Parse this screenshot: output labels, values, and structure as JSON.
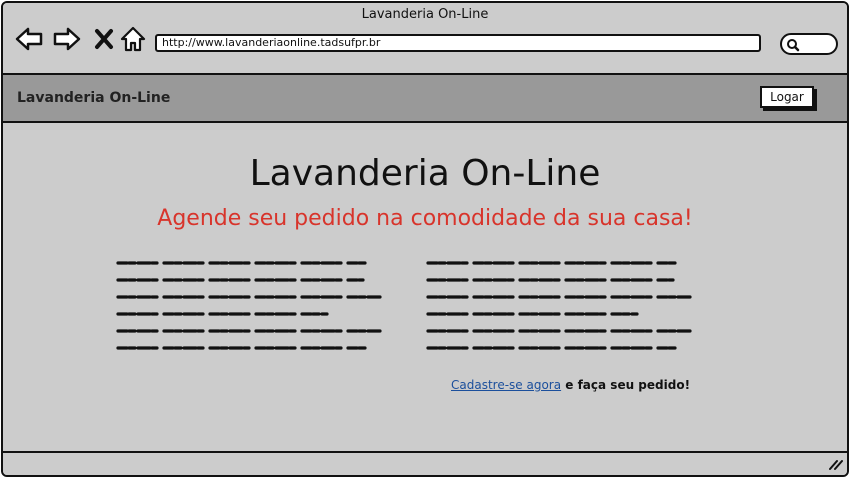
{
  "window": {
    "title": "Lavanderia On-Line"
  },
  "browser": {
    "url": "http://www.lavanderiaonline.tadsufpr.br",
    "icons": [
      "back-arrow-icon",
      "forward-arrow-icon",
      "close-icon",
      "home-icon",
      "search-icon"
    ]
  },
  "header": {
    "app_name": "Lavanderia On-Line",
    "login_label": "Logar"
  },
  "main": {
    "title": "Lavanderia On-Line",
    "subtitle": "Agende seu pedido na comodidade da sua casa!",
    "signup_link": "Cadastre-se agora",
    "signup_suffix": " e faça seu pedido!"
  },
  "colors": {
    "background": "#cccccc",
    "header_bar": "#999999",
    "subtitle": "#d8342b",
    "link": "#1b4f9c"
  }
}
